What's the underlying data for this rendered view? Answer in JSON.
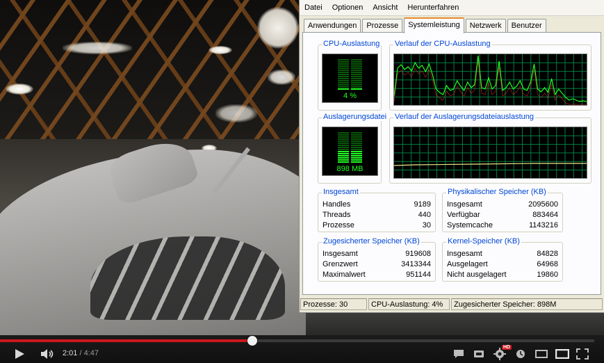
{
  "taskmanager": {
    "menu": [
      "Datei",
      "Optionen",
      "Ansicht",
      "Herunterfahren"
    ],
    "tabs": [
      "Anwendungen",
      "Prozesse",
      "Systemleistung",
      "Netzwerk",
      "Benutzer"
    ],
    "active_tab": "Systemleistung",
    "cpu_usage": {
      "title": "CPU-Auslastung",
      "value": "4 %",
      "fraction": 0.04
    },
    "cpu_history": {
      "title": "Verlauf der CPU-Auslastung"
    },
    "pagefile": {
      "title": "Auslagerungsdatei",
      "value": "898 MB",
      "fraction": 0.43
    },
    "pagefile_history": {
      "title": "Verlauf der Auslagerungsdateiauslastung"
    },
    "totals": {
      "title": "Insgesamt",
      "rows": [
        {
          "label": "Handles",
          "value": "9189"
        },
        {
          "label": "Threads",
          "value": "440"
        },
        {
          "label": "Prozesse",
          "value": "30"
        }
      ]
    },
    "physical_memory": {
      "title": "Physikalischer Speicher (KB)",
      "rows": [
        {
          "label": "Insgesamt",
          "value": "2095600"
        },
        {
          "label": "Verfügbar",
          "value": "883464"
        },
        {
          "label": "Systemcache",
          "value": "1143216"
        }
      ]
    },
    "commit_charge": {
      "title": "Zugesicherter Speicher (KB)",
      "rows": [
        {
          "label": "Insgesamt",
          "value": "919608"
        },
        {
          "label": "Grenzwert",
          "value": "3413344"
        },
        {
          "label": "Maximalwert",
          "value": "951144"
        }
      ]
    },
    "kernel_memory": {
      "title": "Kernel-Speicher (KB)",
      "rows": [
        {
          "label": "Insgesamt",
          "value": "84828"
        },
        {
          "label": "Ausgelagert",
          "value": "64968"
        },
        {
          "label": "Nicht ausgelagert",
          "value": "19860"
        }
      ]
    },
    "status": {
      "processes": "Prozesse: 30",
      "cpu": "CPU-Auslastung: 4%",
      "commit": "Zugesicherter Speicher: 898M"
    }
  },
  "player": {
    "current_time": "2:01",
    "separator": " / ",
    "duration": "4:47",
    "progress": 0.425,
    "buffered": 0.0,
    "hd_badge": "HD",
    "icons": [
      "play-icon",
      "volume-icon",
      "captions-icon",
      "watch-later-icon",
      "settings-icon",
      "clock-icon",
      "small-player-icon",
      "large-player-icon",
      "fullscreen-icon"
    ]
  },
  "colors": {
    "graph_green": "#22ff22",
    "grid": "#008040",
    "progress_red": "#cc181e",
    "title_blue": "#0046d5"
  }
}
